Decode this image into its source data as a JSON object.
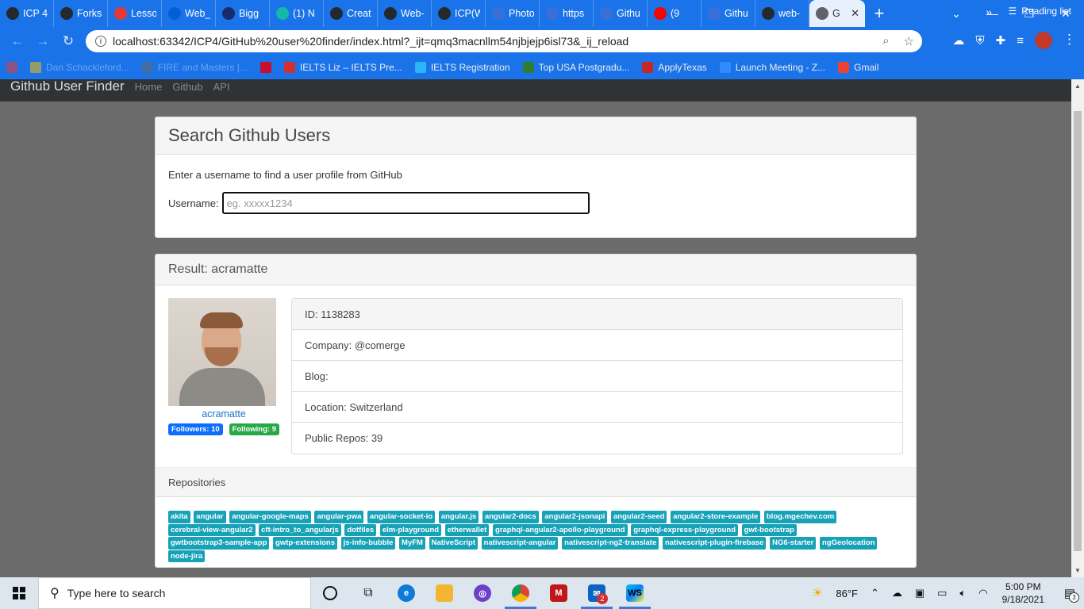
{
  "browser": {
    "tabs": [
      {
        "label": "ICP 4",
        "icon": "github-icon",
        "color": "#24292e"
      },
      {
        "label": "Forks",
        "icon": "github-icon",
        "color": "#24292e"
      },
      {
        "label": "Lesso",
        "icon": "loading-icon",
        "color": "#e53935"
      },
      {
        "label": "Web_",
        "icon": "box-icon",
        "color": "#0061d5"
      },
      {
        "label": "Bigg",
        "icon": "bigg-icon",
        "color": "#1b2a6b"
      },
      {
        "label": "(1) N",
        "icon": "m-icon",
        "color": "#14b8a6"
      },
      {
        "label": "Creat",
        "icon": "github-icon",
        "color": "#24292e"
      },
      {
        "label": "Web-",
        "icon": "github-icon",
        "color": "#24292e"
      },
      {
        "label": "ICP(W",
        "icon": "github-icon",
        "color": "#24292e"
      },
      {
        "label": "Photo",
        "icon": "photo-icon",
        "color": "#3a6fd8"
      },
      {
        "label": "https",
        "icon": "page-icon",
        "color": "#3a6fd8"
      },
      {
        "label": "Githu",
        "icon": "page-icon",
        "color": "#3a6fd8"
      },
      {
        "label": "(9",
        "icon": "youtube-icon",
        "color": "#ff0000"
      },
      {
        "label": "Githu",
        "icon": "page-icon",
        "color": "#3a6fd8"
      },
      {
        "label": "web-",
        "icon": "github-icon",
        "color": "#24292e"
      }
    ],
    "active_tab": {
      "label": "G",
      "icon": "globe-icon"
    },
    "url": "localhost:63342/ICP4/GitHub%20user%20finder/index.html?_ijt=qmq3macnllm54njbjejp6isl73&_ij_reload",
    "bookmarks": [
      {
        "label": "",
        "icon": "apps-icon",
        "color": "#e53935",
        "dim": true
      },
      {
        "label": "Dan Schackleford...",
        "icon": "colorful-icon",
        "color": "#fbbc05",
        "dim": true
      },
      {
        "label": "FIRE and Masters |...",
        "icon": "globe-icon",
        "color": "#666666",
        "dim": true
      },
      {
        "label": "",
        "icon": "shield-icon",
        "color": "#c8102e",
        "dim": false
      },
      {
        "label": "IELTS Liz – IELTS Pre...",
        "icon": "liz-icon",
        "color": "#d32f2f",
        "dim": false
      },
      {
        "label": "IELTS Registration",
        "icon": "ielts-icon",
        "color": "#29b6f6",
        "dim": false
      },
      {
        "label": "Top USA Postgradu...",
        "icon": "h-icon",
        "color": "#2e7d32",
        "dim": false
      },
      {
        "label": "ApplyTexas",
        "icon": "star-icon",
        "color": "#c62828",
        "dim": false
      },
      {
        "label": "Launch Meeting - Z...",
        "icon": "zoom-icon",
        "color": "#2d8cff",
        "dim": false
      },
      {
        "label": "Gmail",
        "icon": "gmail-icon",
        "color": "#ea4335",
        "dim": false
      }
    ],
    "more": "»",
    "reading_list": "Reading list"
  },
  "page_nav": {
    "brand": "Github User Finder",
    "links": [
      "Home",
      "Github",
      "API"
    ]
  },
  "search": {
    "title": "Search Github Users",
    "description": "Enter a username to find a user profile from GitHub",
    "label": "Username:",
    "placeholder": "eg. xxxxx1234"
  },
  "result": {
    "title": "Result: acramatte",
    "username": "acramatte",
    "followers": "Followers: 10",
    "following": "Following: 9",
    "details": [
      "ID: 1138283",
      "Company: @comerge",
      "Blog:",
      "Location: Switzerland",
      "Public Repos: 39"
    ],
    "repos_title": "Repositories",
    "repos": [
      "akita",
      "angular",
      "angular-google-maps",
      "angular-pwa",
      "angular-socket-io",
      "angular.js",
      "angular2-docs",
      "angular2-jsonapi",
      "angular2-seed",
      "angular2-store-example",
      "blog.mgechev.com",
      "cerebral-view-angular2",
      "cft-intro_to_angularjs",
      "dotfiles",
      "elm-playground",
      "etherwallet",
      "graphql-angular2-apollo-playground",
      "graphql-express-playground",
      "gwt-bootstrap",
      "gwtbootstrap3-sample-app",
      "gwtp-extensions",
      "js-info-bubble",
      "MyFM",
      "NativeScript",
      "nativescript-angular",
      "nativescript-ng2-translate",
      "nativescript-plugin-firebase",
      "NG6-starter",
      "ngGeolocation",
      "node-jira"
    ]
  },
  "taskbar": {
    "search_placeholder": "Type here to search",
    "weather": "86°F",
    "time": "5:00 PM",
    "date": "9/18/2021",
    "notifications": "3",
    "mail_badge": "2"
  }
}
